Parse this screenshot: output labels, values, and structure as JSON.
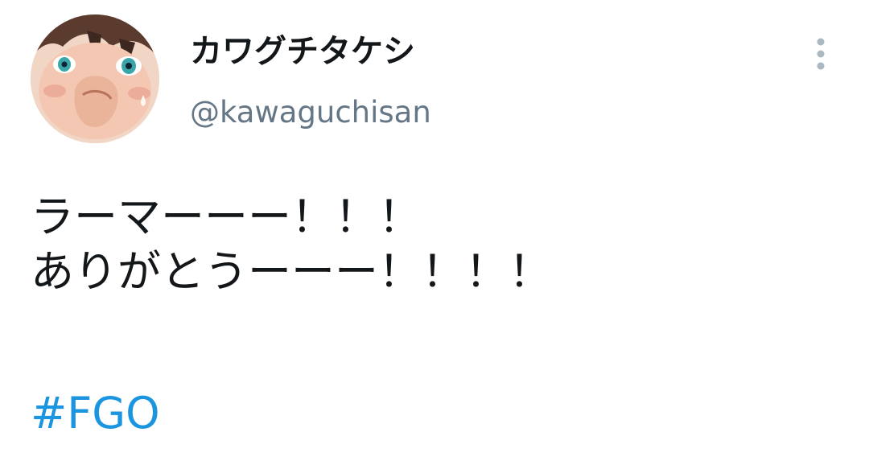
{
  "author": {
    "display_name": "カワグチタケシ",
    "handle": "@kawaguchisan",
    "avatar_icon": "user-avatar-anime-illustration"
  },
  "menu": {
    "icon": "more-vertical-icon"
  },
  "tweet": {
    "lines": [
      "ラーマーーー！！！",
      "ありがとうーーー！！！！"
    ],
    "hashtag": "#FGO"
  },
  "colors": {
    "text": "#14171a",
    "secondary": "#657786",
    "link": "#1b95e0",
    "menu_dots": "#aab8c2",
    "background": "#ffffff"
  }
}
